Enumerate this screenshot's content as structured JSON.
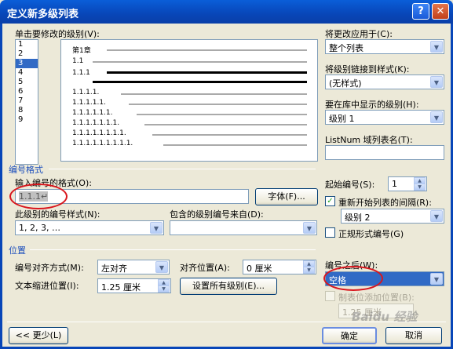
{
  "window": {
    "title": "定义新多级列表",
    "help_glyph": "?",
    "close_glyph": "✕"
  },
  "level_section": {
    "label": "单击要修改的级别(V):",
    "levels": [
      "1",
      "2",
      "3",
      "4",
      "5",
      "6",
      "7",
      "8",
      "9"
    ],
    "selected_level": "3"
  },
  "preview": {
    "rows": [
      "第1章",
      "1.1",
      "1.1.1",
      "1.1.1.1.",
      "1.1.1.1.1.",
      "1.1.1.1.1.1.",
      "1.1.1.1.1.1.1.",
      "1.1.1.1.1.1.1.1.",
      "1.1.1.1.1.1.1.1.1."
    ]
  },
  "right_panel": {
    "apply_label": "将更改应用于(C):",
    "apply_value": "整个列表",
    "link_style_label": "将级别链接到样式(K):",
    "link_style_value": "(无样式)",
    "gallery_level_label": "要在库中显示的级别(H):",
    "gallery_level_value": "级别 1",
    "listnum_label": "ListNum 域列表名(T):",
    "listnum_value": ""
  },
  "number_format": {
    "group_label": "编号格式",
    "format_label": "输入编号的格式(O):",
    "format_value": "1.1.1↵",
    "font_button": "字体(F)...",
    "style_label": "此级别的编号样式(N):",
    "style_value": "1, 2, 3, …",
    "include_label": "包含的级别编号来自(D):",
    "include_value": "",
    "start_label": "起始编号(S):",
    "start_value": "1",
    "restart_label": "重新开始列表的间隔(R):",
    "restart_checked": true,
    "restart_value": "级别 2",
    "legal_label": "正规形式编号(G)",
    "legal_checked": false
  },
  "position": {
    "group_label": "位置",
    "align_label": "编号对齐方式(M):",
    "align_value": "左对齐",
    "align_at_label": "对齐位置(A):",
    "align_at_value": "0 厘米",
    "indent_label": "文本缩进位置(I):",
    "indent_value": "1.25 厘米",
    "set_all_button": "设置所有级别(E)...",
    "follow_label": "编号之后(W):",
    "follow_value": "空格",
    "tab_stop_label": "制表位添加位置(B):",
    "tab_stop_value": "1.25 厘米"
  },
  "footer": {
    "less_button": "<< 更少(L)",
    "ok_button": "确定",
    "cancel_button": "取消"
  },
  "watermark": "Baidu 经验",
  "icons": {
    "combo_arrow": "▼",
    "spin_up": "▲",
    "spin_down": "▼",
    "check": "✓"
  },
  "colors": {
    "title_bar": "#0846b8",
    "selection": "#316ac5",
    "annotation": "#d9161d",
    "group_label": "#1d4fbd"
  }
}
